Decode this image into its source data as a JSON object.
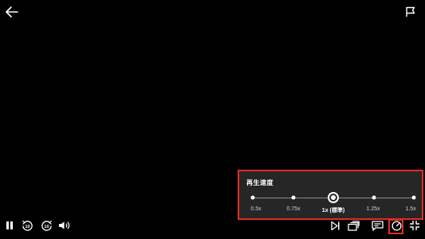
{
  "speed_panel": {
    "title": "再生速度",
    "options": [
      {
        "label": "0.5x",
        "selected": false
      },
      {
        "label": "0.75x",
        "selected": false
      },
      {
        "label": "1x (標準)",
        "selected": true
      },
      {
        "label": "1.25x",
        "selected": false
      },
      {
        "label": "1.5x",
        "selected": false
      }
    ]
  },
  "top_bar": {
    "back_icon": "arrow-left-icon",
    "report_icon": "flag-icon"
  },
  "controls": {
    "left": [
      "pause-icon",
      "rewind-10-icon",
      "forward-10-icon",
      "volume-icon"
    ],
    "right": [
      "next-episode-icon",
      "episodes-icon",
      "subtitles-icon",
      "playback-speed-icon",
      "exit-fullscreen-icon"
    ]
  },
  "colors": {
    "background": "#000000",
    "panel": "#262626",
    "highlight": "#e32b22",
    "text": "#ffffff"
  }
}
